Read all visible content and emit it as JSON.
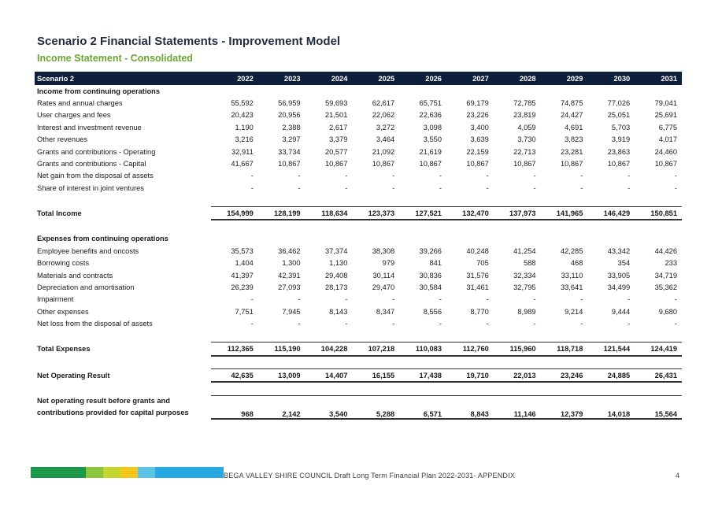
{
  "header": {
    "title": "Scenario 2 Financial Statements - Improvement Model",
    "subtitle": "Income Statement - Consolidated"
  },
  "table": {
    "header_label": "Scenario 2",
    "years": [
      "2022",
      "2023",
      "2024",
      "2025",
      "2026",
      "2027",
      "2028",
      "2029",
      "2030",
      "2031"
    ],
    "rows": [
      {
        "type": "section",
        "label": "Income from continuing operations",
        "values": []
      },
      {
        "type": "row",
        "label": "Rates and annual charges",
        "values": [
          "55,592",
          "56,959",
          "59,693",
          "62,617",
          "65,751",
          "69,179",
          "72,785",
          "74,875",
          "77,026",
          "79,041"
        ]
      },
      {
        "type": "row",
        "label": "User charges and fees",
        "values": [
          "20,423",
          "20,956",
          "21,501",
          "22,062",
          "22,636",
          "23,226",
          "23,819",
          "24,427",
          "25,051",
          "25,691"
        ]
      },
      {
        "type": "row",
        "label": "Interest and investment revenue",
        "values": [
          "1,190",
          "2,388",
          "2,617",
          "3,272",
          "3,098",
          "3,400",
          "4,059",
          "4,691",
          "5,703",
          "6,775"
        ]
      },
      {
        "type": "row",
        "label": "Other revenues",
        "values": [
          "3,216",
          "3,297",
          "3,379",
          "3,464",
          "3,550",
          "3,639",
          "3,730",
          "3,823",
          "3,919",
          "4,017"
        ]
      },
      {
        "type": "row",
        "label": "Grants and contributions - Operating",
        "values": [
          "32,911",
          "33,734",
          "20,577",
          "21,092",
          "21,619",
          "22,159",
          "22,713",
          "23,281",
          "23,863",
          "24,460"
        ]
      },
      {
        "type": "row",
        "label": "Grants and contributions - Capital",
        "values": [
          "41,667",
          "10,867",
          "10,867",
          "10,867",
          "10,867",
          "10,867",
          "10,867",
          "10,867",
          "10,867",
          "10,867"
        ]
      },
      {
        "type": "row",
        "label": "Net gain from the disposal of assets",
        "values": [
          "-",
          "-",
          "-",
          "-",
          "-",
          "-",
          "-",
          "-",
          "-",
          "-"
        ]
      },
      {
        "type": "row",
        "label": "Share of interest in joint ventures",
        "values": [
          "-",
          "-",
          "-",
          "-",
          "-",
          "-",
          "-",
          "-",
          "-",
          "-"
        ]
      },
      {
        "type": "spacer",
        "label": "",
        "values": []
      },
      {
        "type": "total",
        "label": "Total Income",
        "values": [
          "154,999",
          "128,199",
          "118,634",
          "123,373",
          "127,521",
          "132,470",
          "137,973",
          "141,965",
          "146,429",
          "150,851"
        ]
      },
      {
        "type": "spacer",
        "label": "",
        "values": []
      },
      {
        "type": "section",
        "label": "Expenses from continuing operations",
        "values": []
      },
      {
        "type": "row",
        "label": "Employee benefits and oncosts",
        "values": [
          "35,573",
          "36,462",
          "37,374",
          "38,308",
          "39,266",
          "40,248",
          "41,254",
          "42,285",
          "43,342",
          "44,426"
        ]
      },
      {
        "type": "row",
        "label": "Borrowing costs",
        "values": [
          "1,404",
          "1,300",
          "1,130",
          "979",
          "841",
          "705",
          "588",
          "468",
          "354",
          "233"
        ]
      },
      {
        "type": "row",
        "label": "Materials and contracts",
        "values": [
          "41,397",
          "42,391",
          "29,408",
          "30,114",
          "30,836",
          "31,576",
          "32,334",
          "33,110",
          "33,905",
          "34,719"
        ]
      },
      {
        "type": "row",
        "label": "Depreciation and amortisation",
        "values": [
          "26,239",
          "27,093",
          "28,173",
          "29,470",
          "30,584",
          "31,461",
          "32,795",
          "33,641",
          "34,499",
          "35,362"
        ]
      },
      {
        "type": "row",
        "label": "Impairment",
        "values": [
          "-",
          "-",
          "-",
          "-",
          "-",
          "-",
          "-",
          "-",
          "-",
          "-"
        ]
      },
      {
        "type": "row",
        "label": "Other expenses",
        "values": [
          "7,751",
          "7,945",
          "8,143",
          "8,347",
          "8,556",
          "8,770",
          "8,989",
          "9,214",
          "9,444",
          "9,680"
        ]
      },
      {
        "type": "row",
        "label": "Net loss from the disposal of assets",
        "values": [
          "-",
          "-",
          "-",
          "-",
          "-",
          "-",
          "-",
          "-",
          "-",
          "-"
        ]
      },
      {
        "type": "spacer",
        "label": "",
        "values": []
      },
      {
        "type": "total",
        "label": "Total Expenses",
        "values": [
          "112,365",
          "115,190",
          "104,228",
          "107,218",
          "110,083",
          "112,760",
          "115,960",
          "118,718",
          "121,544",
          "124,419"
        ]
      },
      {
        "type": "spacer",
        "label": "",
        "values": []
      },
      {
        "type": "total",
        "label": "Net Operating Result",
        "values": [
          "42,635",
          "13,009",
          "14,407",
          "16,155",
          "17,438",
          "19,710",
          "22,013",
          "23,246",
          "24,885",
          "26,431"
        ]
      },
      {
        "type": "spacer",
        "label": "",
        "values": []
      },
      {
        "type": "total2",
        "label": "Net operating result before grants and",
        "label2": "contributions provided for capital purposes",
        "values": [
          "968",
          "2,142",
          "3,540",
          "5,288",
          "6,571",
          "8,843",
          "11,146",
          "12,379",
          "14,018",
          "15,564"
        ]
      }
    ]
  },
  "footer": {
    "text": "BEGA VALLEY SHIRE COUNCIL  Draft Long Term Financial Plan 2022-2031- APPENDIX",
    "page": "4",
    "bar_colors": [
      "#1b9a4b",
      "#1b9a4b",
      "#8cc63f",
      "#c5d62e",
      "#f5c518",
      "#5bc4e6",
      "#29a9e1"
    ]
  }
}
